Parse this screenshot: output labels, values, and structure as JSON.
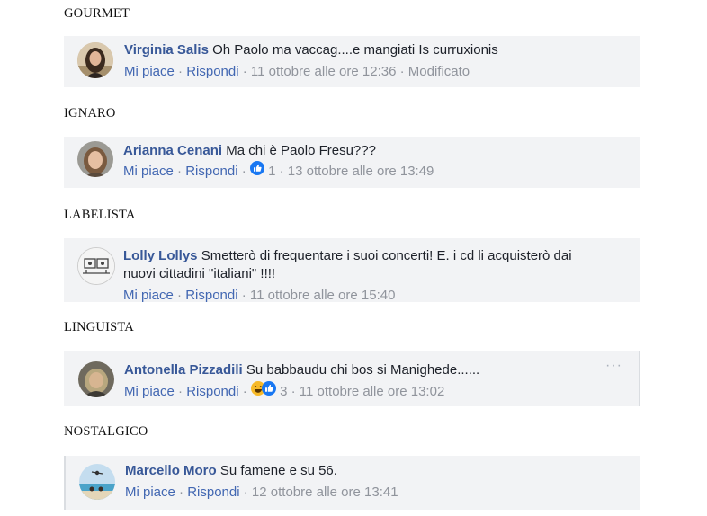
{
  "sections": [
    {
      "label": "GOURMET",
      "author": "Virginia Salis",
      "text": "Oh Paolo ma vaccag....e mangiati Is curruxionis",
      "like": "Mi piace",
      "reply": "Rispondi",
      "time": "11 ottobre alle ore 12:36",
      "edited": "Modificato"
    },
    {
      "label": "IGNARO",
      "author": "Arianna Cenani",
      "text": "Ma chi è Paolo Fresu???",
      "like": "Mi piace",
      "reply": "Rispondi",
      "reaction_count": "1",
      "time": "13 ottobre alle ore 13:49"
    },
    {
      "label": "LABELISTA",
      "author": "Lolly Lollys",
      "text_line1": "Smetterò di frequentare i suoi concerti! E. i cd li acquisterò dai",
      "text_line2": "nuovi cittadini \"italiani\" !!!!",
      "like": "Mi piace",
      "reply": "Rispondi",
      "time": "11 ottobre alle ore 15:40"
    },
    {
      "label": "LINGUISTA",
      "author": "Antonella Pizzadili",
      "text": "Su babbaudu chi bos si Manighede......",
      "like": "Mi piace",
      "reply": "Rispondi",
      "reaction_count": "3",
      "time": "11 ottobre alle ore 13:02",
      "more": "···"
    },
    {
      "label": "NOSTALGICO",
      "author": "Marcello Moro",
      "text": "Su famene e su 56.",
      "like": "Mi piace",
      "reply": "Rispondi",
      "time": "12 ottobre alle ore 13:41"
    }
  ],
  "separator": "·",
  "colors": {
    "name": "#385898",
    "link": "#4267b2",
    "meta": "#90949c",
    "card_bg": "#f2f3f5",
    "like_reaction": "#1877f2",
    "haha_reaction": "#f7b928"
  },
  "icons": [
    "like-reaction-icon",
    "haha-reaction-icon"
  ]
}
